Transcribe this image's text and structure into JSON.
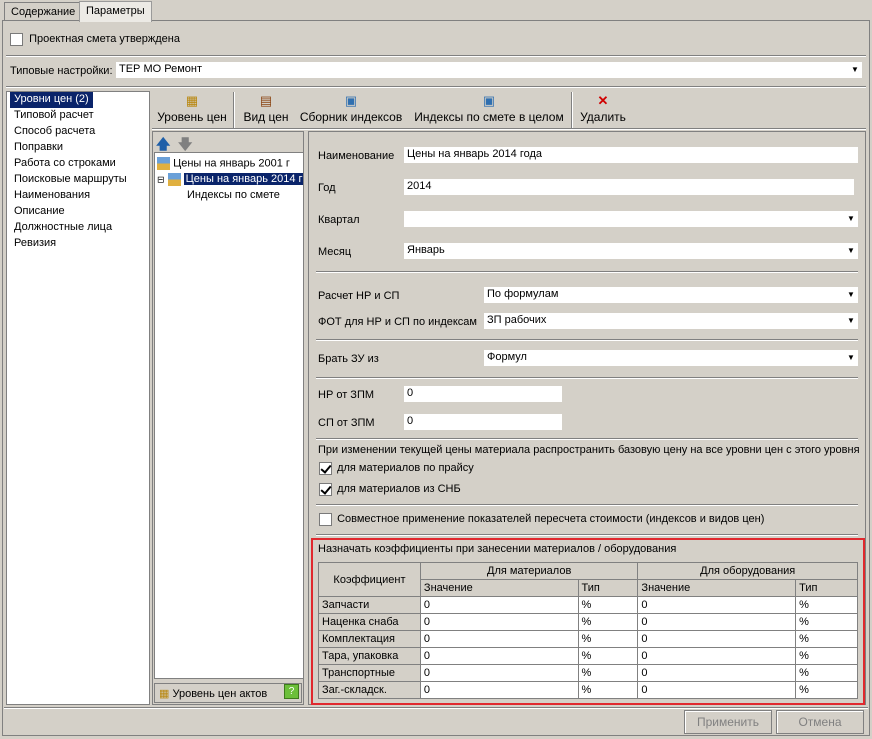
{
  "tabs": [
    {
      "label": "Содержание"
    },
    {
      "label": "Параметры"
    }
  ],
  "approved": {
    "label": "Проектная смета утверждена",
    "checked": false
  },
  "typical": {
    "label": "Типовые настройки:",
    "value": "ТЕР МО Ремонт"
  },
  "nav": {
    "items": [
      {
        "label": "Уровни цен (2)",
        "selected": true
      },
      {
        "label": "Типовой расчет"
      },
      {
        "label": "Способ расчета"
      },
      {
        "label": "Поправки"
      },
      {
        "label": "Работа со строками"
      },
      {
        "label": "Поисковые маршруты"
      },
      {
        "label": "Наименования"
      },
      {
        "label": "Описание"
      },
      {
        "label": "Должностные лица"
      },
      {
        "label": "Ревизия"
      }
    ]
  },
  "toolbar": {
    "price_level": "Уровень цен",
    "price_view": "Вид цен",
    "index_collection": "Сборник индексов",
    "estimate_indexes": "Индексы по смете в целом",
    "delete": "Удалить"
  },
  "tree": {
    "items": [
      "Цены на январь 2001 г",
      "Цены на январь 2014 г",
      "Индексы по смете"
    ],
    "act_level": "Уровень цен актов"
  },
  "form": {
    "name_label": "Наименование",
    "name_value": "Цены на январь 2014 года",
    "year_label": "Год",
    "year_value": "2014",
    "quarter_label": "Квартал",
    "quarter_value": "",
    "month_label": "Месяц",
    "month_value": "Январь",
    "calc_label": "Расчет НР и СП",
    "calc_value": "По формулам",
    "fot_label": "ФОТ для НР и СП по индексам",
    "fot_value": "ЗП рабочих",
    "zu_label": "Брать ЗУ из",
    "zu_value": "Формул",
    "nr_label": "НР от ЗПМ",
    "nr_value": "0",
    "sp_label": "СП от ЗПМ",
    "sp_value": "0",
    "propagate_text": "При изменении текущей цены материала распространить базовую цену на все уровни цен с этого уровня",
    "pricelist_label": "для материалов по прайсу",
    "pricelist_checked": true,
    "snb_label": "для материалов из СНБ",
    "snb_checked": true,
    "joint_label": "Совместное применение показателей пересчета стоимости (индексов и видов цен)",
    "joint_checked": false
  },
  "coef": {
    "title": "Назначать коэффициенты при занесении материалов / оборудования",
    "col_coef": "Коэффициент",
    "col_materials": "Для материалов",
    "col_equipment": "Для оборудования",
    "col_value": "Значение",
    "col_type": "Тип",
    "rows": [
      {
        "name": "Запчасти",
        "mval": "0",
        "mtype": "%",
        "eval": "0",
        "etype": "%"
      },
      {
        "name": "Наценка снаба",
        "mval": "0",
        "mtype": "%",
        "eval": "0",
        "etype": "%"
      },
      {
        "name": "Комплектация",
        "mval": "0",
        "mtype": "%",
        "eval": "0",
        "etype": "%"
      },
      {
        "name": "Тара, упаковка",
        "mval": "0",
        "mtype": "%",
        "eval": "0",
        "etype": "%"
      },
      {
        "name": "Транспортные",
        "mval": "0",
        "mtype": "%",
        "eval": "0",
        "etype": "%"
      },
      {
        "name": "Заг.-складск.",
        "mval": "0",
        "mtype": "%",
        "eval": "0",
        "etype": "%"
      }
    ]
  },
  "buttons": {
    "apply": "Применить",
    "cancel": "Отмена"
  }
}
